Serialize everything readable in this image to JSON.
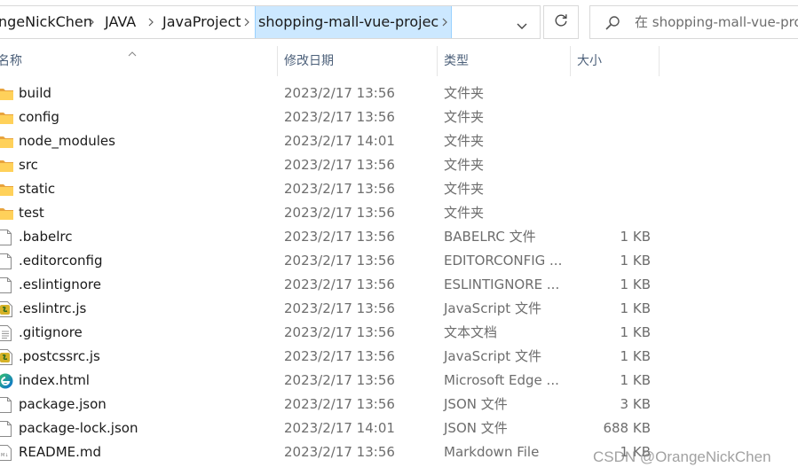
{
  "address_bar": {
    "breadcrumbs": [
      "ngeNickChen",
      "JAVA",
      "JavaProject",
      "shopping-mall-vue-project"
    ],
    "dropdown_icon": "chevron-down-icon",
    "refresh_icon": "refresh-icon"
  },
  "search": {
    "placeholder": "在 shopping-mall-vue-project 中搜索",
    "icon": "search-icon"
  },
  "columns": {
    "name": "名称",
    "modified": "修改日期",
    "type": "类型",
    "size": "大小"
  },
  "files": [
    {
      "name": "build",
      "modified": "2023/2/17 13:56",
      "type": "文件夹",
      "size": "",
      "icon": "folder-icon"
    },
    {
      "name": "config",
      "modified": "2023/2/17 13:56",
      "type": "文件夹",
      "size": "",
      "icon": "folder-icon"
    },
    {
      "name": "node_modules",
      "modified": "2023/2/17 14:01",
      "type": "文件夹",
      "size": "",
      "icon": "folder-icon"
    },
    {
      "name": "src",
      "modified": "2023/2/17 13:56",
      "type": "文件夹",
      "size": "",
      "icon": "folder-icon"
    },
    {
      "name": "static",
      "modified": "2023/2/17 13:56",
      "type": "文件夹",
      "size": "",
      "icon": "folder-icon"
    },
    {
      "name": "test",
      "modified": "2023/2/17 13:56",
      "type": "文件夹",
      "size": "",
      "icon": "folder-icon"
    },
    {
      "name": ".babelrc",
      "modified": "2023/2/17 13:56",
      "type": "BABELRC 文件",
      "size": "1 KB",
      "icon": "file-icon"
    },
    {
      "name": ".editorconfig",
      "modified": "2023/2/17 13:56",
      "type": "EDITORCONFIG ...",
      "size": "1 KB",
      "icon": "file-icon"
    },
    {
      "name": ".eslintignore",
      "modified": "2023/2/17 13:56",
      "type": "ESLINTIGNORE ...",
      "size": "1 KB",
      "icon": "file-icon"
    },
    {
      "name": ".eslintrc.js",
      "modified": "2023/2/17 13:56",
      "type": "JavaScript 文件",
      "size": "1 KB",
      "icon": "js-file-icon"
    },
    {
      "name": ".gitignore",
      "modified": "2023/2/17 13:56",
      "type": "文本文档",
      "size": "1 KB",
      "icon": "text-file-icon"
    },
    {
      "name": ".postcssrc.js",
      "modified": "2023/2/17 13:56",
      "type": "JavaScript 文件",
      "size": "1 KB",
      "icon": "js-file-icon"
    },
    {
      "name": "index.html",
      "modified": "2023/2/17 13:56",
      "type": "Microsoft Edge ...",
      "size": "1 KB",
      "icon": "edge-icon"
    },
    {
      "name": "package.json",
      "modified": "2023/2/17 13:56",
      "type": "JSON 文件",
      "size": "3 KB",
      "icon": "file-icon"
    },
    {
      "name": "package-lock.json",
      "modified": "2023/2/17 14:01",
      "type": "JSON 文件",
      "size": "688 KB",
      "icon": "file-icon"
    },
    {
      "name": "README.md",
      "modified": "2023/2/17 13:56",
      "type": "Markdown File",
      "size": "1 KB",
      "icon": "markdown-file-icon"
    }
  ],
  "watermark": "CSDN @OrangeNickChen"
}
